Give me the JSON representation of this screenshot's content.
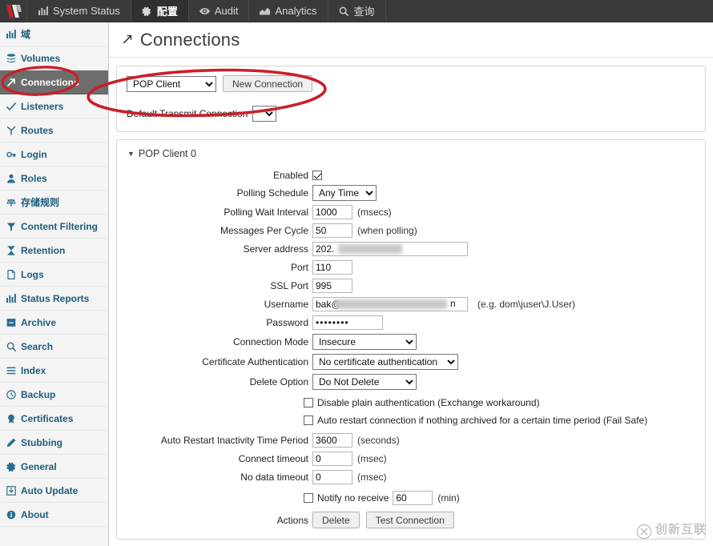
{
  "topnav": {
    "brand_icon": "logo-icon",
    "items": [
      {
        "label": "System Status",
        "icon": "bar-chart-icon",
        "active": false
      },
      {
        "label": "配置",
        "icon": "gear-icon",
        "active": true
      },
      {
        "label": "Audit",
        "icon": "eye-icon",
        "active": false
      },
      {
        "label": "Analytics",
        "icon": "area-chart-icon",
        "active": false
      },
      {
        "label": "查询",
        "icon": "search-icon",
        "active": false
      }
    ]
  },
  "sidebar": {
    "items": [
      {
        "label": "域",
        "icon": "bar-chart-icon",
        "active": false
      },
      {
        "label": "Volumes",
        "icon": "stack-icon",
        "active": false
      },
      {
        "label": "Connections",
        "icon": "arrow-up-right-icon",
        "active": true
      },
      {
        "label": "Listeners",
        "icon": "check-wave-icon",
        "active": false
      },
      {
        "label": "Routes",
        "icon": "branch-icon",
        "active": false
      },
      {
        "label": "Login",
        "icon": "key-icon",
        "active": false
      },
      {
        "label": "Roles",
        "icon": "user-icon",
        "active": false
      },
      {
        "label": "存储规则",
        "icon": "scales-icon",
        "active": false
      },
      {
        "label": "Content Filtering",
        "icon": "funnel-icon",
        "active": false
      },
      {
        "label": "Retention",
        "icon": "hourglass-icon",
        "active": false
      },
      {
        "label": "Logs",
        "icon": "document-icon",
        "active": false
      },
      {
        "label": "Status Reports",
        "icon": "bar-chart-icon",
        "active": false
      },
      {
        "label": "Archive",
        "icon": "archive-box-icon",
        "active": false
      },
      {
        "label": "Search",
        "icon": "search-icon",
        "active": false
      },
      {
        "label": "Index",
        "icon": "list-icon",
        "active": false
      },
      {
        "label": "Backup",
        "icon": "clock-icon",
        "active": false
      },
      {
        "label": "Certificates",
        "icon": "seal-icon",
        "active": false
      },
      {
        "label": "Stubbing",
        "icon": "pencil-icon",
        "active": false
      },
      {
        "label": "General",
        "icon": "gear-icon",
        "active": false
      },
      {
        "label": "Auto Update",
        "icon": "download-box-icon",
        "active": false
      },
      {
        "label": "About",
        "icon": "info-icon",
        "active": false
      }
    ]
  },
  "page": {
    "title": "Connections",
    "title_icon": "arrow-up-right-icon"
  },
  "toolbar": {
    "connection_type_selected": "POP Client",
    "connection_type_options": [
      "POP Client"
    ],
    "new_connection_label": "New Connection",
    "default_transmit_label": "Default Transmit Connection",
    "default_transmit_selected": "",
    "default_transmit_options": [
      ""
    ]
  },
  "form": {
    "section_title": "POP Client 0",
    "enabled": {
      "label": "Enabled",
      "checked": true
    },
    "polling_schedule": {
      "label": "Polling Schedule",
      "value": "Any Time",
      "options": [
        "Any Time"
      ]
    },
    "polling_wait_interval": {
      "label": "Polling Wait Interval",
      "value": "1000",
      "unit": "(msecs)"
    },
    "messages_per_cycle": {
      "label": "Messages Per Cycle",
      "value": "50",
      "unit": "(when polling)"
    },
    "server_address": {
      "label": "Server address",
      "value": "202."
    },
    "port": {
      "label": "Port",
      "value": "110"
    },
    "ssl_port": {
      "label": "SSL Port",
      "value": "995"
    },
    "username": {
      "label": "Username",
      "value": "bak@",
      "value_tail": "n",
      "hint": "(e.g. dom\\juser\\J.User)"
    },
    "password": {
      "label": "Password",
      "value": "••••••••"
    },
    "connection_mode": {
      "label": "Connection Mode",
      "value": "Insecure",
      "options": [
        "Insecure"
      ]
    },
    "certificate_authentication": {
      "label": "Certificate Authentication",
      "value": "No certificate authentication",
      "options": [
        "No certificate authentication"
      ]
    },
    "delete_option": {
      "label": "Delete Option",
      "value": "Do Not Delete",
      "options": [
        "Do Not Delete"
      ]
    },
    "disable_plain_auth": {
      "label": "Disable plain authentication (Exchange workaround)",
      "checked": false
    },
    "auto_restart": {
      "label": "Auto restart connection if nothing archived for a certain time period (Fail Safe)",
      "checked": false
    },
    "auto_restart_inactivity": {
      "label": "Auto Restart Inactivity Time Period",
      "value": "3600",
      "unit": "(seconds)"
    },
    "connect_timeout": {
      "label": "Connect timeout",
      "value": "0",
      "unit": "(msec)"
    },
    "no_data_timeout": {
      "label": "No data timeout",
      "value": "0",
      "unit": "(msec)"
    },
    "notify_no_receive": {
      "label": "Notify no receive",
      "checked": false,
      "value": "60",
      "unit": "(min)"
    },
    "actions": {
      "label": "Actions",
      "delete_label": "Delete",
      "test_connection_label": "Test Connection"
    }
  },
  "annotations": {
    "color": "#c8202a",
    "ellipses": [
      {
        "name": "connections-sidebar-highlight"
      },
      {
        "name": "new-connection-toolbar-highlight"
      }
    ]
  },
  "watermark": {
    "text": "创新互联",
    "subtext": "CHUANGXIN HULIAN"
  },
  "colors": {
    "topnav_bg": "#3a3a3a",
    "sidebar_bg": "#f4f4f4",
    "sidebar_link": "#1d5c7e",
    "sidebar_active_bg": "#6d6d6d",
    "annotation_red": "#c8202a",
    "panel_border": "#d4d4d4"
  }
}
